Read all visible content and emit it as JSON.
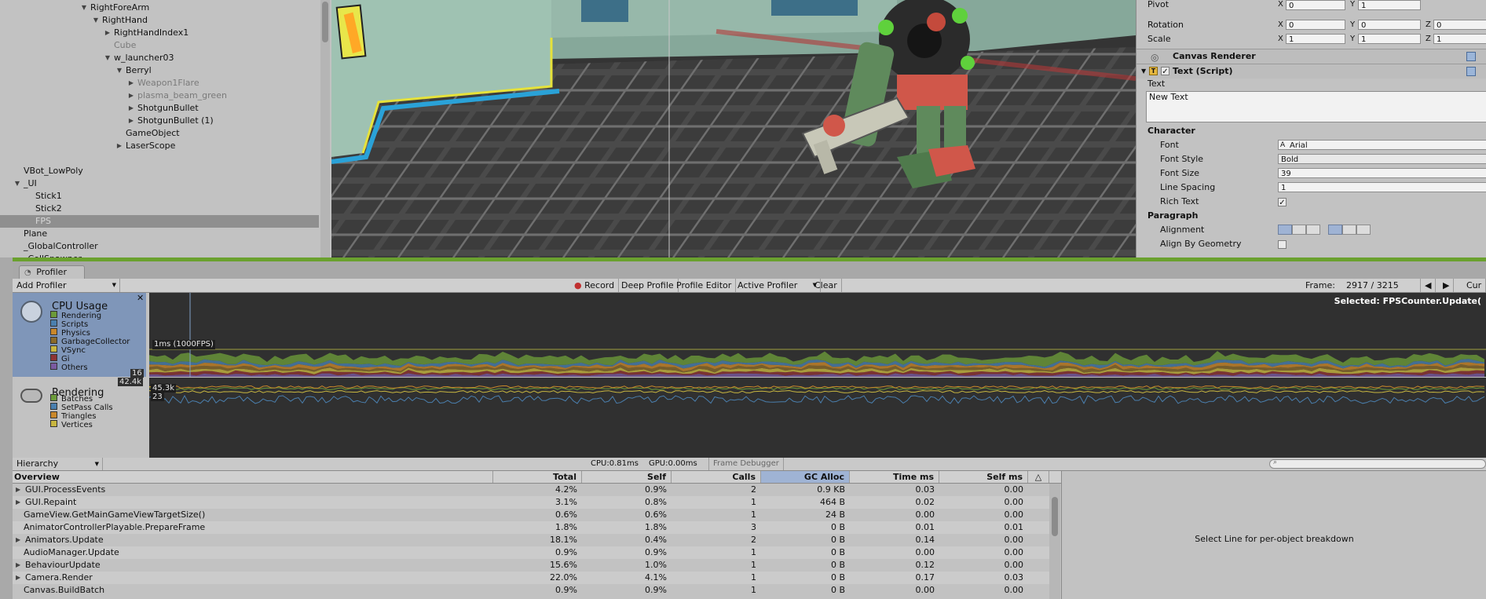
{
  "hierarchy": {
    "items": [
      {
        "label": "RightForeArm",
        "indent": 115,
        "arrow": "▼",
        "state": "normal"
      },
      {
        "label": "RightHand",
        "indent": 130,
        "arrow": "▼",
        "state": "normal"
      },
      {
        "label": "RightHandIndex1",
        "indent": 145,
        "arrow": "▶",
        "state": "normal"
      },
      {
        "label": "Cube",
        "indent": 145,
        "arrow": "",
        "state": "dim"
      },
      {
        "label": "w_launcher03",
        "indent": 145,
        "arrow": "▼",
        "state": "normal"
      },
      {
        "label": "Berryl",
        "indent": 160,
        "arrow": "▼",
        "state": "normal"
      },
      {
        "label": "Weapon1Flare",
        "indent": 175,
        "arrow": "▶",
        "state": "dim"
      },
      {
        "label": "plasma_beam_green",
        "indent": 175,
        "arrow": "▶",
        "state": "dim"
      },
      {
        "label": "ShotgunBullet",
        "indent": 175,
        "arrow": "▶",
        "state": "normal"
      },
      {
        "label": "ShotgunBullet (1)",
        "indent": 175,
        "arrow": "▶",
        "state": "normal"
      },
      {
        "label": "GameObject",
        "indent": 160,
        "arrow": "",
        "state": "normal"
      },
      {
        "label": "LaserScope",
        "indent": 160,
        "arrow": "▶",
        "state": "normal"
      },
      {
        "label": "",
        "indent": 0,
        "arrow": "",
        "state": "normal"
      },
      {
        "label": "VBot_LowPoly",
        "indent": 30,
        "arrow": "",
        "state": "normal"
      },
      {
        "label": "_UI",
        "indent": 30,
        "arrow": "▼",
        "state": "normal"
      },
      {
        "label": "Stick1",
        "indent": 45,
        "arrow": "",
        "state": "normal"
      },
      {
        "label": "Stick2",
        "indent": 45,
        "arrow": "",
        "state": "normal"
      },
      {
        "label": "FPS",
        "indent": 45,
        "arrow": "",
        "state": "selected"
      },
      {
        "label": "Plane",
        "indent": 30,
        "arrow": "",
        "state": "normal"
      },
      {
        "label": "_GlobalController",
        "indent": 30,
        "arrow": "",
        "state": "normal"
      },
      {
        "label": "_CellSpawner",
        "indent": 30,
        "arrow": "",
        "state": "normal"
      }
    ]
  },
  "inspector": {
    "pivot": {
      "label": "Pivot",
      "x": "0",
      "y": "1"
    },
    "rotation": {
      "label": "Rotation",
      "x": "0",
      "y": "0",
      "z": "0"
    },
    "scale": {
      "label": "Scale",
      "x": "1",
      "y": "1",
      "z": "1"
    },
    "canvas_renderer": "Canvas Renderer",
    "text_script": "Text (Script)",
    "text_label": "Text",
    "text_value": "New Text",
    "character": "Character",
    "font": {
      "label": "Font",
      "value": "Arial"
    },
    "font_style": {
      "label": "Font Style",
      "value": "Bold"
    },
    "font_size": {
      "label": "Font Size",
      "value": "39"
    },
    "line_spacing": {
      "label": "Line Spacing",
      "value": "1"
    },
    "rich_text": {
      "label": "Rich Text",
      "checked": "✓"
    },
    "paragraph": "Paragraph",
    "alignment": {
      "label": "Alignment"
    },
    "align_geometry": {
      "label": "Align By Geometry"
    }
  },
  "profiler": {
    "tab_label": "Profiler",
    "add_profiler": "Add Profiler",
    "toolbar": {
      "record": "Record",
      "deep_profile": "Deep Profile",
      "profile_editor": "Profile Editor",
      "active_profiler": "Active Profiler",
      "clear": "Clear",
      "frame_label": "Frame:",
      "frame_value": "2917 / 3215",
      "current": "Cur"
    },
    "selected_text": "Selected: FPSCounter.Update(",
    "cpu": {
      "title": "CPU Usage",
      "legend": [
        {
          "name": "Rendering",
          "color": "#6b9a3a"
        },
        {
          "name": "Scripts",
          "color": "#4a7fae"
        },
        {
          "name": "Physics",
          "color": "#c9872a"
        },
        {
          "name": "GarbageCollector",
          "color": "#8a6a2a"
        },
        {
          "name": "VSync",
          "color": "#c8b640"
        },
        {
          "name": "Gi",
          "color": "#8e3434"
        },
        {
          "name": "Others",
          "color": "#7a5aa0"
        }
      ],
      "marker_label": "1ms (1000FPS)"
    },
    "rendering": {
      "title": "Rendering",
      "legend": [
        {
          "name": "Batches",
          "color": "#6b9a3a"
        },
        {
          "name": "SetPass Calls",
          "color": "#4a7fae"
        },
        {
          "name": "Triangles",
          "color": "#c9872a"
        },
        {
          "name": "Vertices",
          "color": "#c8b640"
        }
      ],
      "badge_top": "16",
      "badge_mid": "42.4k",
      "graph_top": "45.3k",
      "graph_bottom": "23"
    },
    "table": {
      "view_mode": "Hierarchy",
      "cpu_time": "CPU:0.81ms",
      "gpu_time": "GPU:0.00ms",
      "frame_debugger": "Frame Debugger",
      "columns": [
        "Overview",
        "Total",
        "Self",
        "Calls",
        "GC Alloc",
        "Time ms",
        "Self ms"
      ],
      "rows": [
        {
          "name": "GUI.ProcessEvents",
          "expand": "▶",
          "total": "4.2%",
          "self": "0.9%",
          "calls": "2",
          "gc": "0.9 KB",
          "time": "0.03",
          "selfms": "0.00"
        },
        {
          "name": "GUI.Repaint",
          "expand": "▶",
          "total": "3.1%",
          "self": "0.8%",
          "calls": "1",
          "gc": "464 B",
          "time": "0.02",
          "selfms": "0.00"
        },
        {
          "name": "GameView.GetMainGameViewTargetSize()",
          "expand": "",
          "total": "0.6%",
          "self": "0.6%",
          "calls": "1",
          "gc": "24 B",
          "time": "0.00",
          "selfms": "0.00"
        },
        {
          "name": "AnimatorControllerPlayable.PrepareFrame",
          "expand": "",
          "total": "1.8%",
          "self": "1.8%",
          "calls": "3",
          "gc": "0 B",
          "time": "0.01",
          "selfms": "0.01"
        },
        {
          "name": "Animators.Update",
          "expand": "▶",
          "total": "18.1%",
          "self": "0.4%",
          "calls": "2",
          "gc": "0 B",
          "time": "0.14",
          "selfms": "0.00"
        },
        {
          "name": "AudioManager.Update",
          "expand": "",
          "total": "0.9%",
          "self": "0.9%",
          "calls": "1",
          "gc": "0 B",
          "time": "0.00",
          "selfms": "0.00"
        },
        {
          "name": "BehaviourUpdate",
          "expand": "▶",
          "total": "15.6%",
          "self": "1.0%",
          "calls": "1",
          "gc": "0 B",
          "time": "0.12",
          "selfms": "0.00"
        },
        {
          "name": "Camera.Render",
          "expand": "▶",
          "total": "22.0%",
          "self": "4.1%",
          "calls": "1",
          "gc": "0 B",
          "time": "0.17",
          "selfms": "0.03"
        },
        {
          "name": "Canvas.BuildBatch",
          "expand": "",
          "total": "0.9%",
          "self": "0.9%",
          "calls": "1",
          "gc": "0 B",
          "time": "0.00",
          "selfms": "0.00"
        }
      ],
      "detail_hint": "Select Line for per-object breakdown"
    }
  }
}
